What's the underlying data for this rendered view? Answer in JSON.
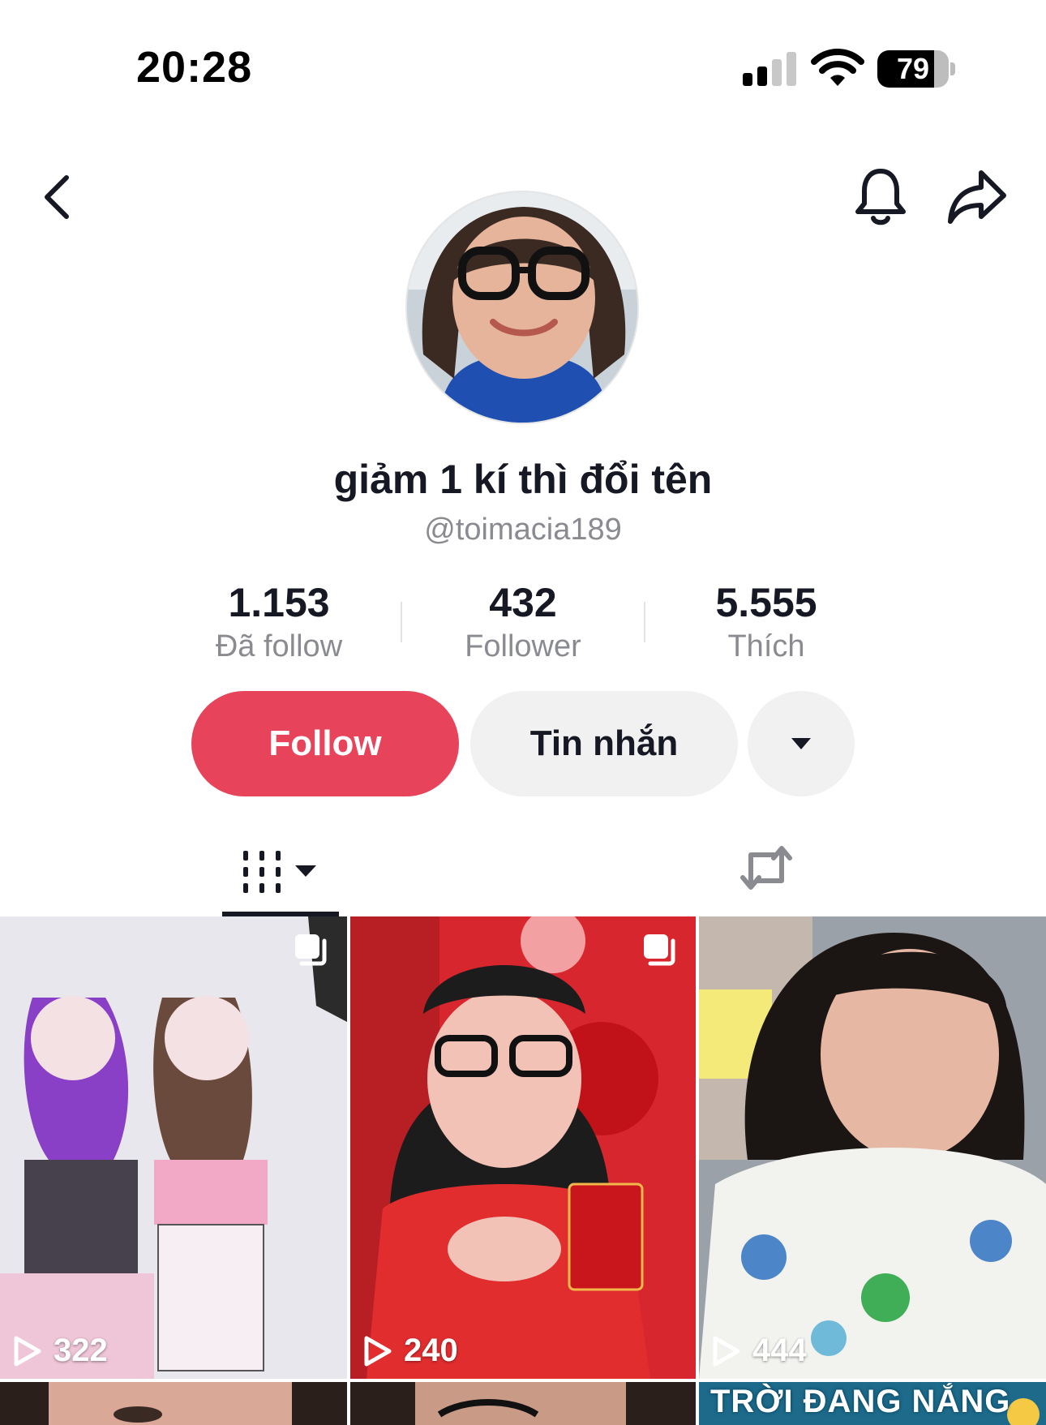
{
  "status_bar": {
    "time": "20:28",
    "battery_level": "79",
    "battery_fraction": 0.79
  },
  "profile": {
    "display_name": "giảm 1 kí thì đổi tên",
    "username": "@toimacia189"
  },
  "stats": [
    {
      "value": "1.153",
      "label": "Đã follow"
    },
    {
      "value": "432",
      "label": "Follower"
    },
    {
      "value": "5.555",
      "label": "Thích"
    }
  ],
  "actions": {
    "follow_label": "Follow",
    "message_label": "Tin nhắn"
  },
  "videos": [
    {
      "views": "322",
      "multi_photo": true
    },
    {
      "views": "240",
      "multi_photo": true
    },
    {
      "views": "444",
      "multi_photo": false
    }
  ],
  "partial_row": {
    "banner_text": "TRỜI ĐANG NẮNG"
  },
  "colors": {
    "accent": "#e7435a",
    "text_primary": "#161823",
    "text_secondary": "#8a8b91",
    "button_secondary": "#f1f1f2"
  },
  "icons": [
    "back-icon",
    "bell-icon",
    "share-icon",
    "caret-down-icon",
    "grid-view-icon",
    "repost-icon",
    "play-icon",
    "multi-photo-icon"
  ]
}
